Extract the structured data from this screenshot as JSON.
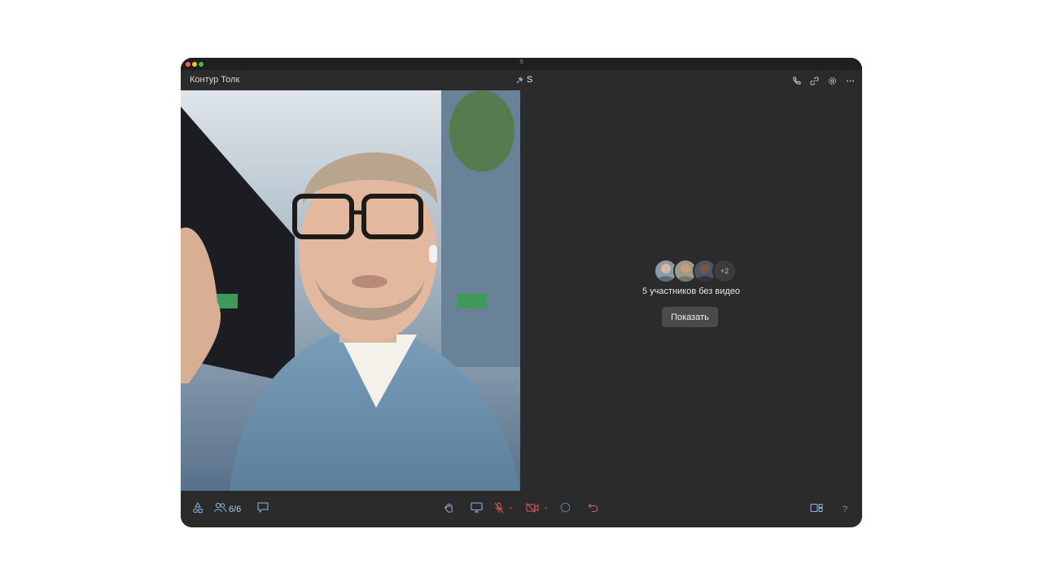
{
  "window": {
    "title": "S"
  },
  "app": {
    "name": "Контур Толк"
  },
  "room": {
    "name": "S",
    "icon": "pin-icon"
  },
  "top_icons": [
    "phone-icon",
    "link-icon",
    "settings-icon",
    "more-icon"
  ],
  "main": {
    "no_video_text": "5 участников без видео",
    "show_button": "Показать",
    "avatars_more": "+2"
  },
  "bottom": {
    "participants_count": "6/6",
    "help_label": "?"
  },
  "colors": {
    "accent_blue": "#8fb6e6",
    "danger_red": "#e05a5a",
    "bg_dark": "#2b2b2b"
  }
}
